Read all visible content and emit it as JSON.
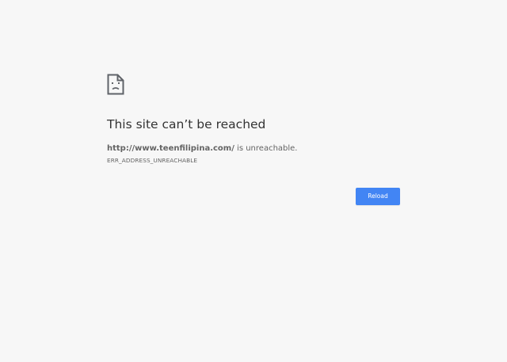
{
  "error": {
    "icon": "sad-page-icon",
    "title": "This site can’t be reached",
    "url": "http://www.teenfilipina.com/",
    "message_suffix": " is unreachable.",
    "code": "ERR_ADDRESS_UNREACHABLE"
  },
  "actions": {
    "reload_label": "Reload"
  },
  "colors": {
    "background": "#f7f7f7",
    "title": "#333333",
    "text": "#646464",
    "button": "#4285f4"
  }
}
